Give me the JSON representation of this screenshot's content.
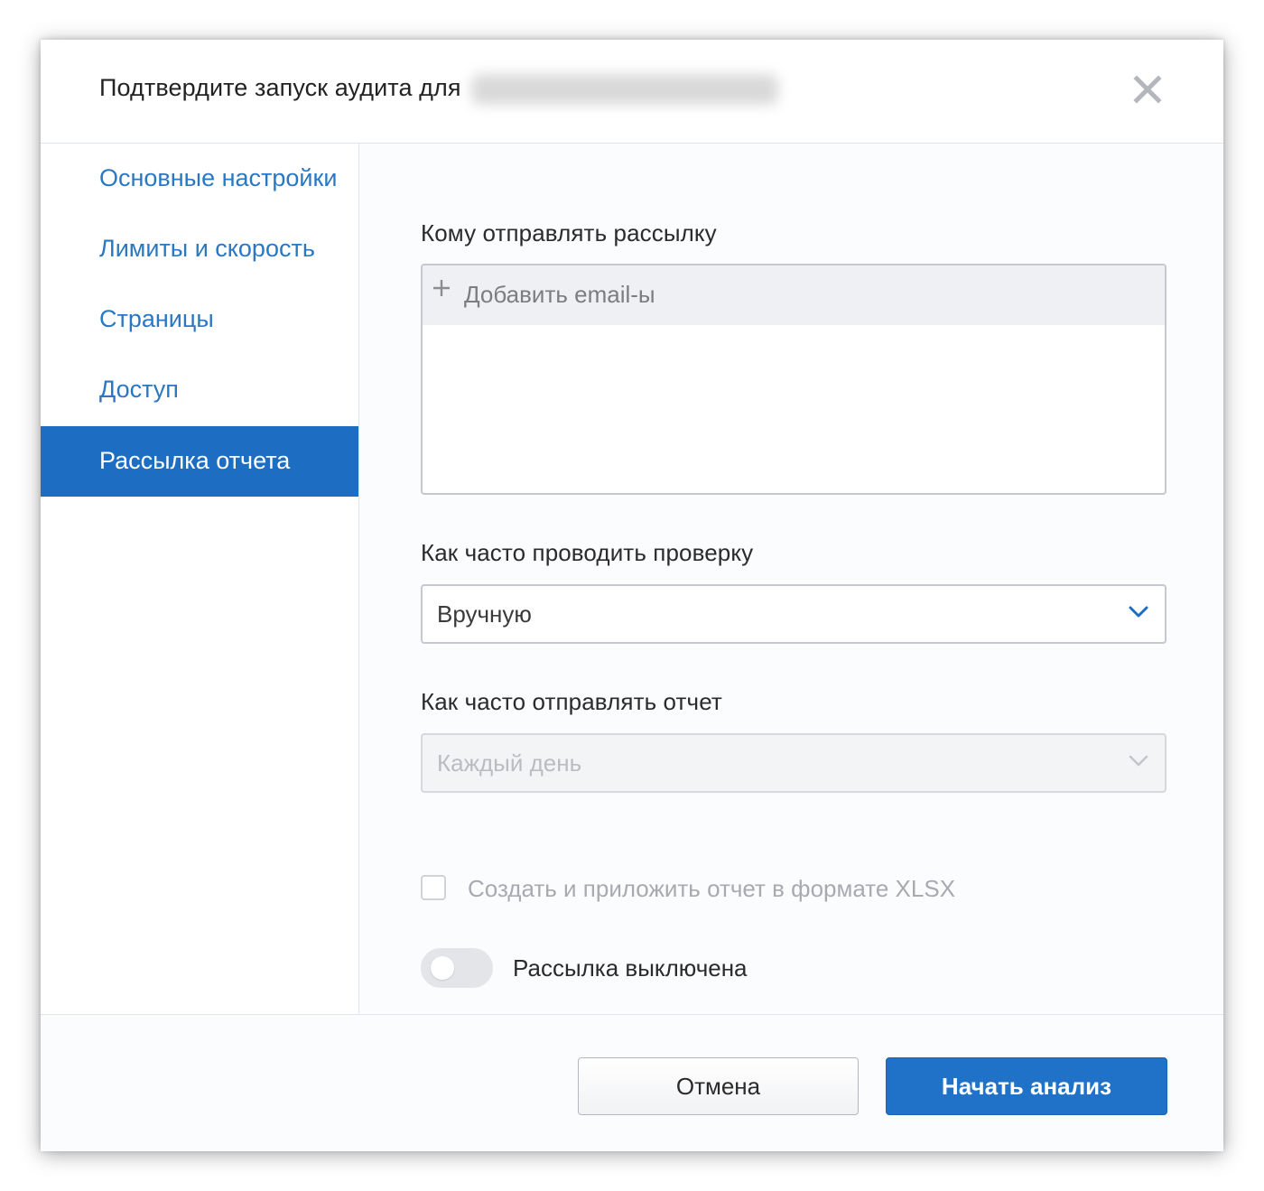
{
  "modal": {
    "title": "Подтвердите запуск аудита для",
    "close_icon": "close-icon"
  },
  "sidebar": {
    "items": [
      {
        "label": "Основные настройки",
        "active": false
      },
      {
        "label": "Лимиты и скорость",
        "active": false
      },
      {
        "label": "Страницы",
        "active": false
      },
      {
        "label": "Доступ",
        "active": false
      },
      {
        "label": "Рассылка отчета",
        "active": true
      }
    ]
  },
  "content": {
    "recipients_label": "Кому отправлять рассылку",
    "add_email_placeholder": "Добавить email-ы",
    "check_frequency_label": "Как часто проводить проверку",
    "check_frequency_value": "Вручную",
    "report_frequency_label": "Как часто отправлять отчет",
    "report_frequency_value": "Каждый день",
    "xlsx_checkbox_label": "Создать и приложить отчет в формате XLSX",
    "xlsx_checkbox_checked": false,
    "mailing_toggle_label": "Рассылка выключена",
    "mailing_toggle_on": false
  },
  "footer": {
    "cancel_label": "Отмена",
    "start_label": "Начать анализ"
  },
  "colors": {
    "accent": "#1d6ec3",
    "link": "#2a78c2",
    "primary_button": "#1f72c8"
  }
}
